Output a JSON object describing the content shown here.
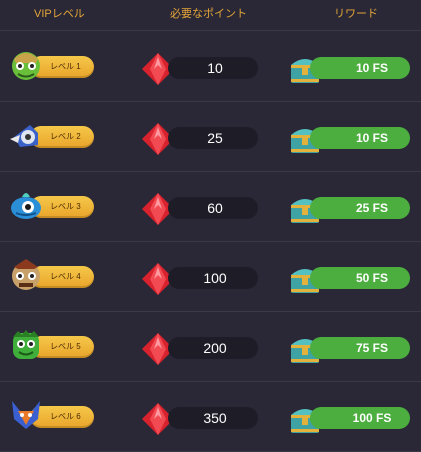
{
  "header": {
    "vip_level": "VIPレベル",
    "required_points": "必要なポイント",
    "reward": "リワード"
  },
  "rows": [
    {
      "level": "レベル 1",
      "points": "10",
      "reward": "10 FS",
      "avatar_icon": "frog-warrior-icon",
      "avatar_color": "#6abf3a"
    },
    {
      "level": "レベル 2",
      "points": "25",
      "reward": "10 FS",
      "avatar_icon": "knight-helmet-icon",
      "avatar_color": "#3a62c9"
    },
    {
      "level": "レベル 3",
      "points": "60",
      "reward": "25 FS",
      "avatar_icon": "fish-creature-icon",
      "avatar_color": "#2a8fd6"
    },
    {
      "level": "レベル 4",
      "points": "100",
      "reward": "50 FS",
      "avatar_icon": "tribal-mask-icon",
      "avatar_color": "#c8a06a"
    },
    {
      "level": "レベル 5",
      "points": "200",
      "reward": "75 FS",
      "avatar_icon": "green-monster-icon",
      "avatar_color": "#3fae3a"
    },
    {
      "level": "レベル 6",
      "points": "350",
      "reward": "100 FS",
      "avatar_icon": "fox-warrior-icon",
      "avatar_color": "#3a5fd0"
    }
  ],
  "colors": {
    "background": "#2a2836",
    "header_text": "#e3a538",
    "level_pill": "#eeb43a",
    "points_pill": "#1d1c27",
    "reward_pill": "#4cae3f",
    "gem": "#d8232f"
  }
}
